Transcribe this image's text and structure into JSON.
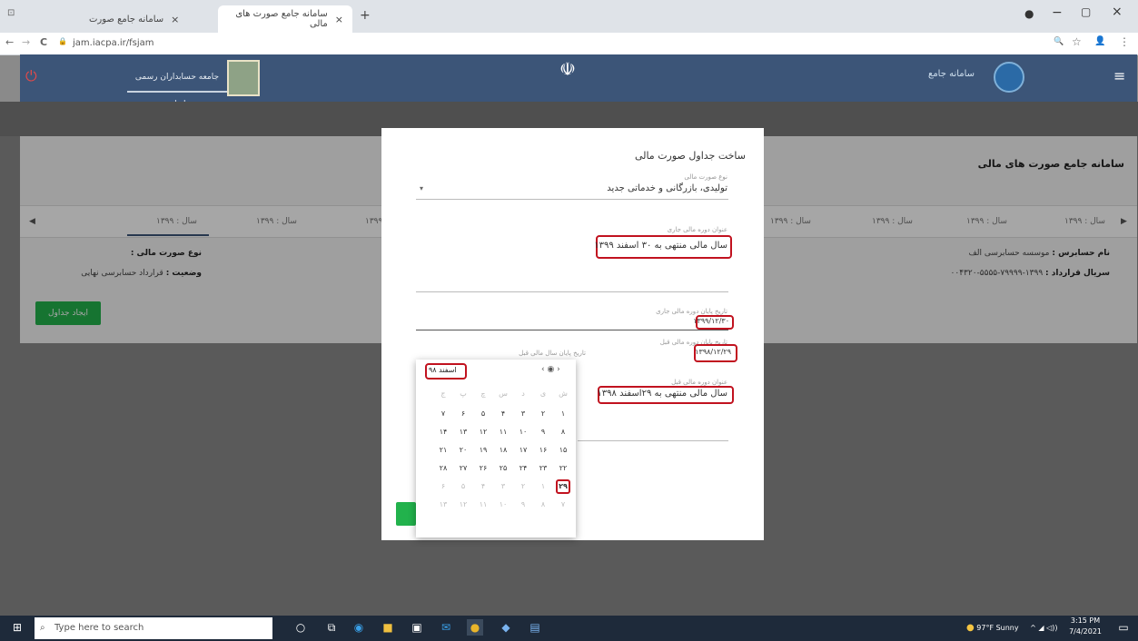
{
  "browser": {
    "tabs": [
      {
        "label": "سامانه جامع صورت"
      },
      {
        "label": "سامانه جامع صورت های مالی"
      }
    ],
    "new_tab": "+",
    "close_glyph": "×",
    "url": "jam.iacpa.ir/fsjam",
    "nav": {
      "back": "←",
      "forward": "→",
      "reload": "C",
      "lock": "🔒"
    },
    "window_controls": {
      "record": "●",
      "minimize": "−",
      "maximize": "▢",
      "close": "×"
    },
    "toolbar_icons": {
      "zoom": "🔍",
      "star": "☆",
      "profile": "👤",
      "menu": "⋮"
    }
  },
  "site": {
    "brand_right": "سامانه جامع",
    "brand_center": "جامعه حسابداران رسمی ایران",
    "icon_left": "⏻",
    "icon_right": "≡",
    "page_title": "سامانه جامع صورت های مالی"
  },
  "year_tabs": [
    "سال : ۱۳۹۹",
    "سال : ۱۳۹۹",
    "سال : ۱۳۹۹",
    "سال : ۱۳۹۹",
    "سال : ۱۳۹۹",
    "سال : ۱۳۹۹",
    "سال : ۱۳۹۹"
  ],
  "info": {
    "auditor_label": "نام حسابرس :",
    "auditor_value": "موسسه حسابرسی الف",
    "contract_label": "سریال قرارداد :",
    "contract_value": "۱۳۹۹-۷۹۹۹۹-۵۵۵۵-۰۰۴۳۲۰",
    "type_label": "نوع صورت مالی :",
    "type_value": "",
    "status_label": "وضعیت :",
    "status_value": "قرارداد حسابرسی نهایی"
  },
  "create_button": "ایجاد جداول",
  "modal": {
    "title": "ساخت جداول صورت مالی",
    "field1_label": "نوع صورت مالی",
    "field1_value": "تولیدی، بازرگانی و خدماتی جدید",
    "field2_label": "عنوان دوره مالی جاری",
    "field2_value": "سال مالی منتهی به ۳۰ اسفند ۱۳۹۹",
    "field3_label": "",
    "field3_value": "",
    "field4_label": "تاریخ پایان دوره مالی جاری",
    "field4_value": "۱۳۹۹/۱۲/۳۰",
    "field5_label": "تاریخ پایان دوره مالی قبل",
    "field5_value": "۱۳۹۸/۱۲/۲۹",
    "field5b_label": "تاریخ پایان سال مالی قبل",
    "field6_label": "عنوان دوره مالی قبل",
    "field6_value": "سال مالی منتهی به ۲۹اسفند ۱۳۹۸"
  },
  "calendar": {
    "month_label": "اسفند ۹۸",
    "nav": "‹ ◉ ›",
    "weekdays": [
      "ش",
      "ی",
      "د",
      "س",
      "چ",
      "پ",
      "ج"
    ],
    "rows": [
      [
        "۱",
        "۲",
        "۳",
        "۴",
        "۵",
        "۶",
        "۷"
      ],
      [
        "۸",
        "۹",
        "۱۰",
        "۱۱",
        "۱۲",
        "۱۳",
        "۱۴"
      ],
      [
        "۱۵",
        "۱۶",
        "۱۷",
        "۱۸",
        "۱۹",
        "۲۰",
        "۲۱"
      ],
      [
        "۲۲",
        "۲۳",
        "۲۴",
        "۲۵",
        "۲۶",
        "۲۷",
        "۲۸"
      ],
      [
        "۲۹",
        "۱",
        "۲",
        "۳",
        "۴",
        "۵",
        "۶"
      ],
      [
        "۷",
        "۸",
        "۹",
        "۱۰",
        "۱۱",
        "۱۲",
        "۱۳"
      ]
    ],
    "selected": "۲۹"
  },
  "taskbar": {
    "search_placeholder": "Type here to search",
    "weather": "97°F Sunny",
    "time": "3:15 PM",
    "date": "7/4/2021",
    "icons": [
      "windows-start-icon",
      "cortana-icon",
      "taskview-icon",
      "edge-icon",
      "explorer-icon",
      "store-icon",
      "mail-icon",
      "chrome-icon",
      "app-icon",
      "app2-icon"
    ]
  }
}
